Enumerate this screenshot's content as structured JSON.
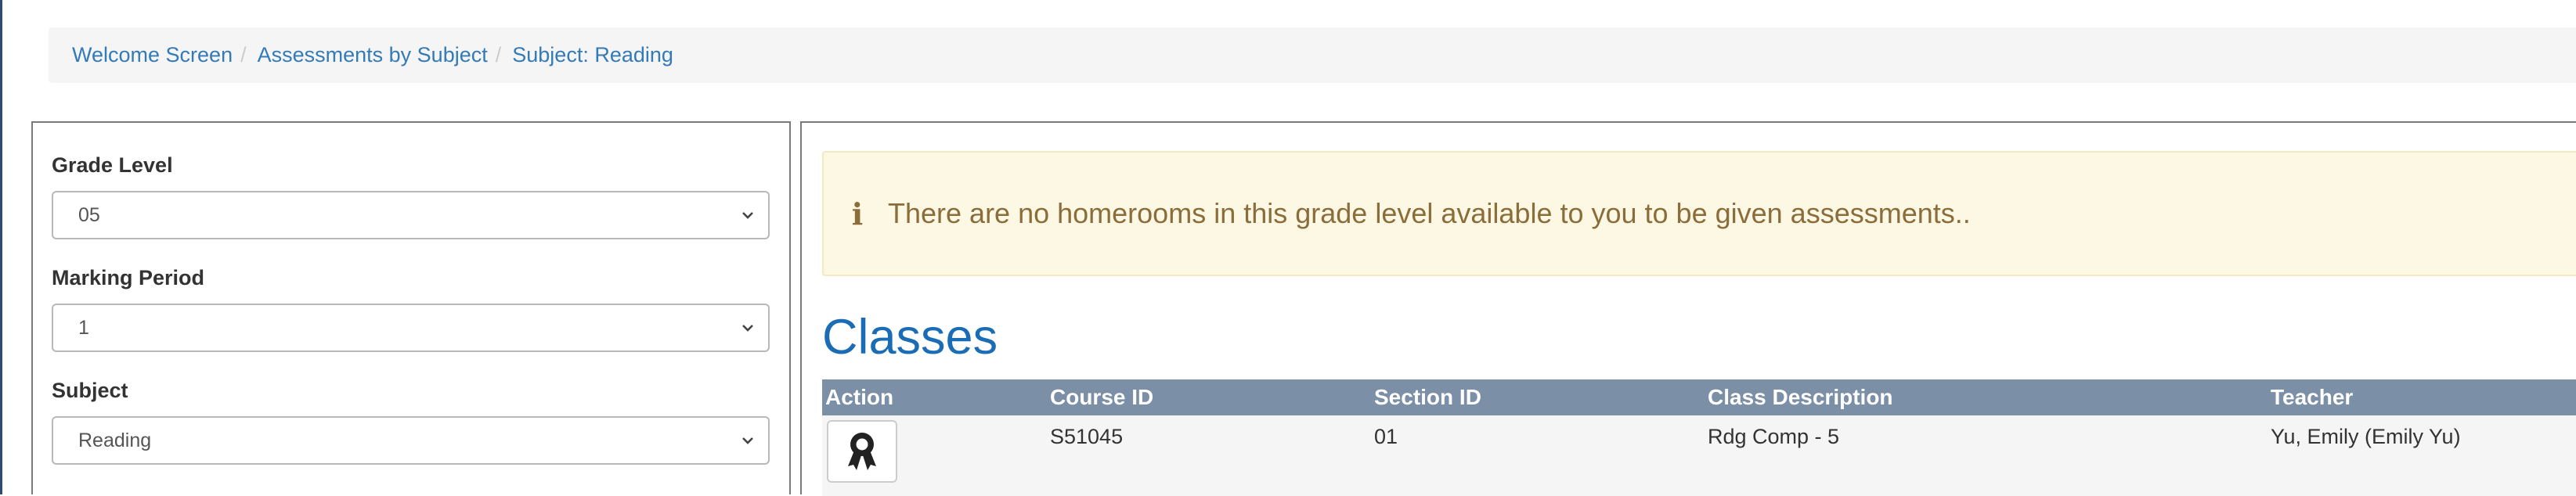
{
  "breadcrumb": {
    "items": [
      {
        "label": "Welcome Screen"
      },
      {
        "label": "Assessments by Subject"
      },
      {
        "label": "Subject: Reading"
      }
    ],
    "separator": "/"
  },
  "filters": {
    "grade_level": {
      "label": "Grade Level",
      "value": "05"
    },
    "marking_period": {
      "label": "Marking Period",
      "value": "1"
    },
    "subject": {
      "label": "Subject",
      "value": "Reading"
    }
  },
  "alert": {
    "icon": "info-icon",
    "message": "There are no homerooms in this grade level available to you to be given assessments.."
  },
  "classes": {
    "title": "Classes",
    "columns": [
      "Action",
      "Course ID",
      "Section ID",
      "Class Description",
      "Teacher"
    ],
    "rows": [
      {
        "action_icon": "award-ribbon-icon",
        "course_id": "S51045",
        "section_id": "01",
        "description": "Rdg Comp - 5",
        "teacher": "Yu, Emily (Emily Yu)"
      }
    ]
  },
  "colors": {
    "link": "#337ab7",
    "title": "#1a6db5",
    "table_header": "#7b8fa6",
    "alert_bg": "#fcf8e3",
    "alert_text": "#8a6d3b"
  }
}
